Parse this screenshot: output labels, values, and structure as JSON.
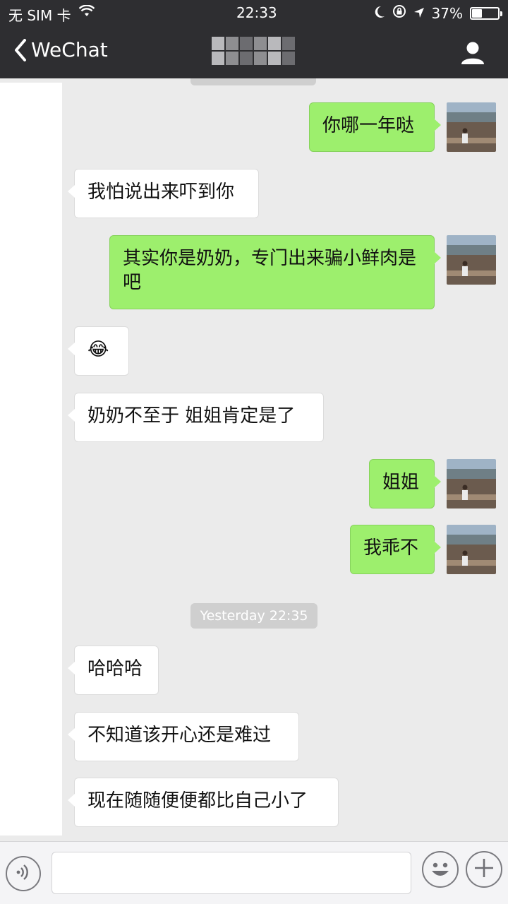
{
  "status_bar": {
    "carrier": "无 SIM 卡",
    "time": "22:33",
    "battery": "37%",
    "battery_level": 0.37
  },
  "nav": {
    "back_label": "WeChat"
  },
  "messages": [
    {
      "side": "out",
      "text": "你哪一年哒"
    },
    {
      "side": "in",
      "text": "我怕说出来吓到你"
    },
    {
      "side": "out",
      "text": "其实你是奶奶，专门出来骗小鲜肉是吧"
    },
    {
      "side": "in",
      "text": "😂"
    },
    {
      "side": "in",
      "text": "奶奶不至于 姐姐肯定是了"
    },
    {
      "side": "out",
      "text": "姐姐"
    },
    {
      "side": "out",
      "text": "我乖不"
    },
    {
      "side": "in",
      "text": "哈哈哈"
    },
    {
      "side": "in",
      "text": "不知道该开心还是难过"
    },
    {
      "side": "in",
      "text": "现在随随便便都比自己小了"
    }
  ],
  "timestamp": "Yesterday 22:35",
  "input": {
    "placeholder": ""
  },
  "icons": [
    "wifi-icon",
    "moon-icon",
    "rotation-lock-icon",
    "location-arrow-icon",
    "battery-icon",
    "chevron-left-icon",
    "person-icon",
    "voice-icon",
    "emoji-icon",
    "plus-icon"
  ]
}
